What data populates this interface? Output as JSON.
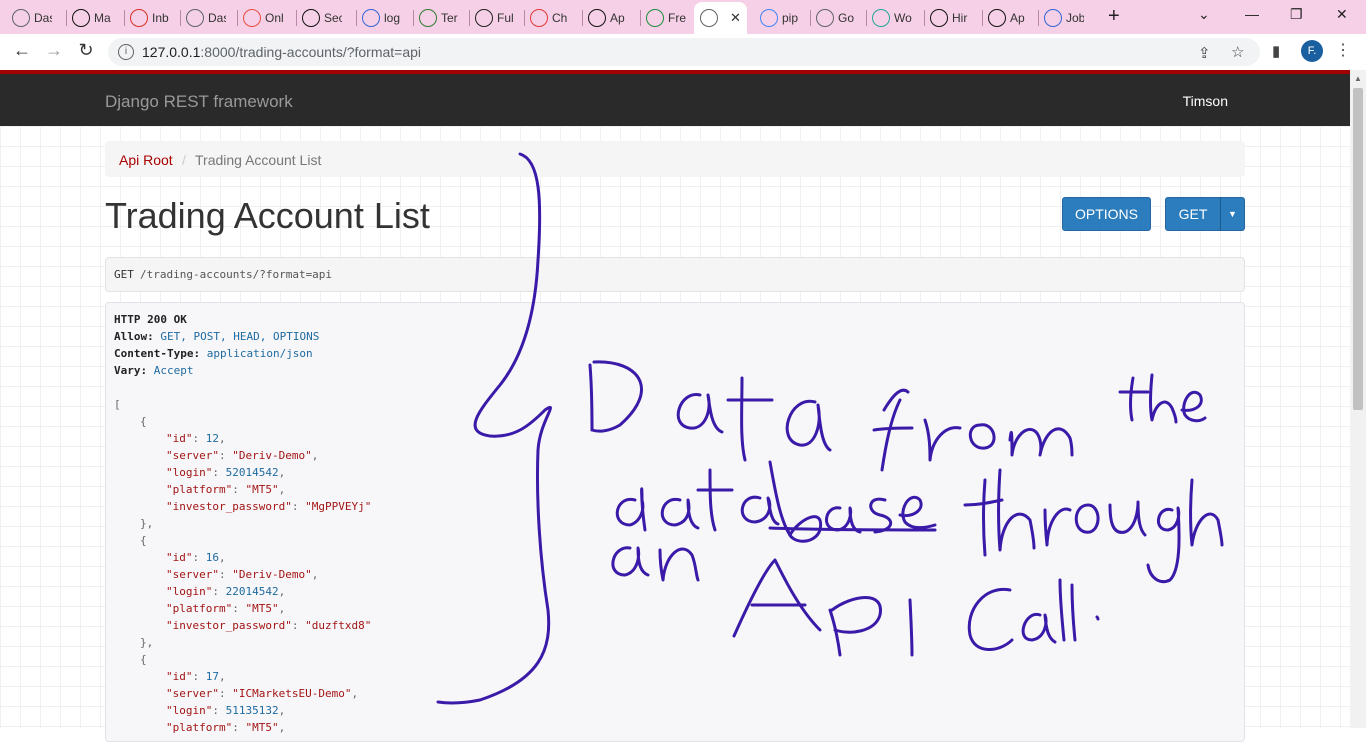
{
  "browser": {
    "tabs": [
      {
        "label": "Das",
        "icon": "globe-icon",
        "color": "#5f6368"
      },
      {
        "label": "Ma",
        "icon": "openai-icon",
        "color": "#111111"
      },
      {
        "label": "Inb",
        "icon": "gmail-icon",
        "color": "#d93025"
      },
      {
        "label": "Das",
        "icon": "globe-icon",
        "color": "#5f6368"
      },
      {
        "label": "Onl",
        "icon": "d-app-icon",
        "color": "#e74c3c"
      },
      {
        "label": "Sec",
        "icon": "chart-app-icon",
        "color": "#111111"
      },
      {
        "label": "log",
        "icon": "graduation-cap-icon",
        "color": "#3367d6"
      },
      {
        "label": "Ter",
        "icon": "triangle-app-icon",
        "color": "#2e7d32"
      },
      {
        "label": "Ful",
        "icon": "trading-app-icon",
        "color": "#222222"
      },
      {
        "label": "Ch",
        "icon": "swoosh-app-icon",
        "color": "#e53935"
      },
      {
        "label": "Ap",
        "icon": "a-app-icon",
        "color": "#111111"
      },
      {
        "label": "Fre",
        "icon": "chat-app-icon",
        "color": "#1e8e3e"
      },
      {
        "label": "",
        "icon": "globe-icon",
        "color": "#5f6368",
        "active": true
      },
      {
        "label": "pip",
        "icon": "google-icon",
        "color": "#4285f4"
      },
      {
        "label": "Go",
        "icon": "globe-icon",
        "color": "#5f6368"
      },
      {
        "label": "Wo",
        "icon": "cube-app-icon",
        "color": "#26a69a"
      },
      {
        "label": "Hir",
        "icon": "hire-app-icon",
        "color": "#111111"
      },
      {
        "label": "Ap",
        "icon": "openai-icon",
        "color": "#111111"
      },
      {
        "label": "Job",
        "icon": "info-app-icon",
        "color": "#3367d6"
      }
    ],
    "url_host": "127.0.0.1",
    "url_rest": ":8000/trading-accounts/?format=api",
    "profile_initial": "F."
  },
  "navbar": {
    "brand": "Django REST framework",
    "user": "Timson"
  },
  "breadcrumb": {
    "root": "Api Root",
    "separator": "/",
    "current": "Trading Account List"
  },
  "page": {
    "title": "Trading Account List",
    "options_label": "OPTIONS",
    "get_label": "GET"
  },
  "request": {
    "method": "GET",
    "path": "/trading-accounts/?format=api"
  },
  "response": {
    "status": "HTTP 200 OK",
    "headers": [
      {
        "key": "Allow:",
        "value": "GET, POST, HEAD, OPTIONS"
      },
      {
        "key": "Content-Type:",
        "value": "application/json"
      },
      {
        "key": "Vary:",
        "value": "Accept"
      }
    ],
    "items": [
      {
        "id": "12",
        "server": "\"Deriv-Demo\"",
        "login": "52014542",
        "platform": "\"MT5\"",
        "investor_password": "\"MgPPVEYj\""
      },
      {
        "id": "16",
        "server": "\"Deriv-Demo\"",
        "login": "22014542",
        "platform": "\"MT5\"",
        "investor_password": "\"duzftxd8\""
      },
      {
        "id": "17",
        "server": "\"ICMarketsEU-Demo\"",
        "login": "51135132",
        "platform": "\"MT5\""
      }
    ],
    "keys": {
      "id": "\"id\"",
      "server": "\"server\"",
      "login": "\"login\"",
      "platform": "\"platform\"",
      "investor_password": "\"investor_password\""
    }
  },
  "annotation": {
    "handwritten_text": "Data from the database through an API Call.",
    "ink_color": "#3a1aa8"
  }
}
